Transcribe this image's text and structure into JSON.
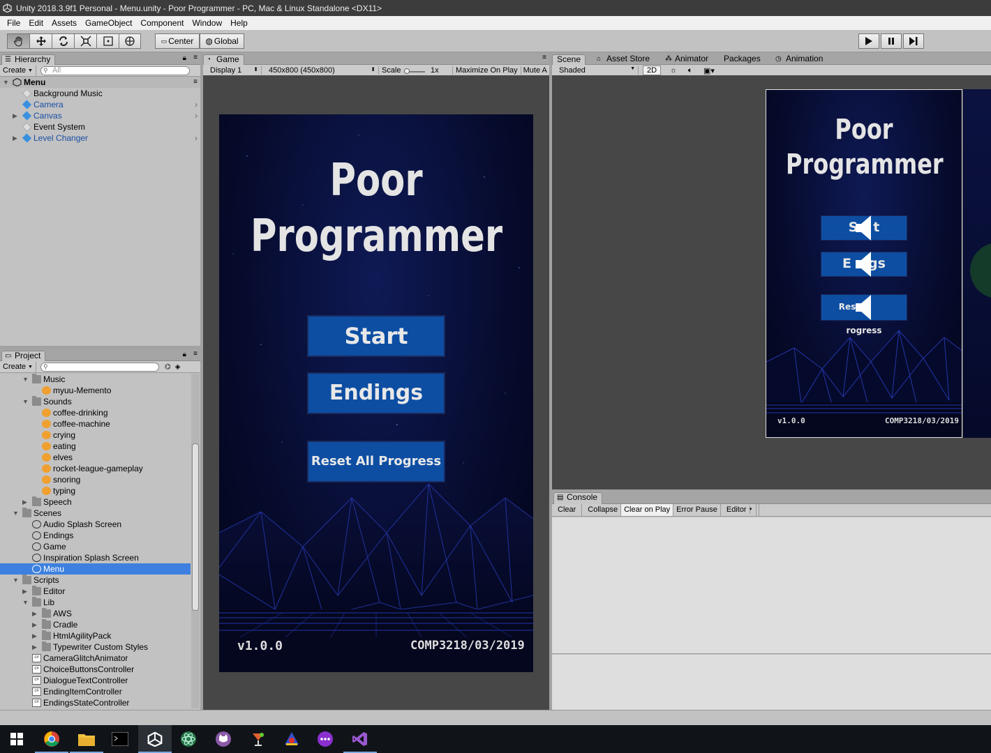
{
  "window": {
    "title": "Unity 2018.3.9f1 Personal - Menu.unity - Poor Programmer - PC, Mac & Linux Standalone <DX11>"
  },
  "menu": [
    "File",
    "Edit",
    "Assets",
    "GameObject",
    "Component",
    "Window",
    "Help"
  ],
  "toolbar": {
    "pivot": "Center",
    "space": "Global"
  },
  "hierarchy": {
    "tab": "Hierarchy",
    "create": "Create",
    "search": "All",
    "scene": "Menu",
    "items": [
      {
        "label": "Background Music",
        "blue": false,
        "expand": false
      },
      {
        "label": "Camera",
        "blue": true,
        "expand": false
      },
      {
        "label": "Canvas",
        "blue": true,
        "expand": true
      },
      {
        "label": "Event System",
        "blue": false,
        "expand": false
      },
      {
        "label": "Level Changer",
        "blue": true,
        "expand": true
      }
    ]
  },
  "project": {
    "tab": "Project",
    "create": "Create",
    "items": [
      {
        "label": "Music",
        "type": "folder",
        "indent": 1,
        "open": true
      },
      {
        "label": "myuu-Memento",
        "type": "sound",
        "indent": 2
      },
      {
        "label": "Sounds",
        "type": "folder",
        "indent": 1,
        "open": true
      },
      {
        "label": "coffee-drinking",
        "type": "sound",
        "indent": 2
      },
      {
        "label": "coffee-machine",
        "type": "sound",
        "indent": 2
      },
      {
        "label": "crying",
        "type": "sound",
        "indent": 2
      },
      {
        "label": "eating",
        "type": "sound",
        "indent": 2
      },
      {
        "label": "elves",
        "type": "sound",
        "indent": 2
      },
      {
        "label": "rocket-league-gameplay",
        "type": "sound",
        "indent": 2
      },
      {
        "label": "snoring",
        "type": "sound",
        "indent": 2
      },
      {
        "label": "typing",
        "type": "sound",
        "indent": 2
      },
      {
        "label": "Speech",
        "type": "folder",
        "indent": 1,
        "open": false
      },
      {
        "label": "Scenes",
        "type": "folder",
        "indent": 0,
        "open": true
      },
      {
        "label": "Audio Splash Screen",
        "type": "scene",
        "indent": 1
      },
      {
        "label": "Endings",
        "type": "scene",
        "indent": 1
      },
      {
        "label": "Game",
        "type": "scene",
        "indent": 1
      },
      {
        "label": "Inspiration Splash Screen",
        "type": "scene",
        "indent": 1
      },
      {
        "label": "Menu",
        "type": "scene",
        "indent": 1,
        "selected": true
      },
      {
        "label": "Scripts",
        "type": "folder",
        "indent": 0,
        "open": true
      },
      {
        "label": "Editor",
        "type": "folder",
        "indent": 1,
        "open": false
      },
      {
        "label": "Lib",
        "type": "folder",
        "indent": 1,
        "open": true
      },
      {
        "label": "AWS",
        "type": "folder",
        "indent": 2,
        "open": false
      },
      {
        "label": "Cradle",
        "type": "folder",
        "indent": 2,
        "open": false
      },
      {
        "label": "HtmlAgilityPack",
        "type": "folder",
        "indent": 2,
        "open": false
      },
      {
        "label": "Typewriter Custom Styles",
        "type": "folder",
        "indent": 2,
        "open": false
      },
      {
        "label": "CameraGlitchAnimator",
        "type": "script",
        "indent": 1
      },
      {
        "label": "ChoiceButtonsController",
        "type": "script",
        "indent": 1
      },
      {
        "label": "DialogueTextController",
        "type": "script",
        "indent": 1
      },
      {
        "label": "EndingItemController",
        "type": "script",
        "indent": 1
      },
      {
        "label": "EndingsStateController",
        "type": "script",
        "indent": 1
      }
    ]
  },
  "game": {
    "tab": "Game",
    "display": "Display 1",
    "resolution": "450x800 (450x800)",
    "scale_label": "Scale",
    "scale_value": "1x",
    "maximize": "Maximize On Play",
    "mute": "Mute A",
    "title1": "Poor",
    "title2": "Programmer",
    "btn_start": "Start",
    "btn_endings": "Endings",
    "btn_reset": "Reset All Progress",
    "version": "v1.0.0",
    "credit": "COMP3218/03/2019"
  },
  "scene": {
    "tabs": [
      "Scene",
      "Asset Store",
      "Animator",
      "Packages",
      "Animation"
    ],
    "shading": "Shaded",
    "mode2d": "2D",
    "title1": "Poor",
    "title2": "Programmer",
    "btn_start_a": "S",
    "btn_start_b": "t",
    "btn_endings_a": "E",
    "btn_endings_b": "gs",
    "btn_reset_a": "Reset",
    "btn_reset_b": "rogress",
    "version": "v1.0.0",
    "credit": "COMP3218/03/2019"
  },
  "console": {
    "tab": "Console",
    "buttons": [
      "Clear",
      "Collapse",
      "Clear on Play",
      "Error Pause",
      "Editor"
    ]
  },
  "colors": {
    "accent": "#3d80df",
    "game_button": "#0d4ea3",
    "game_bg": "#070c30"
  }
}
